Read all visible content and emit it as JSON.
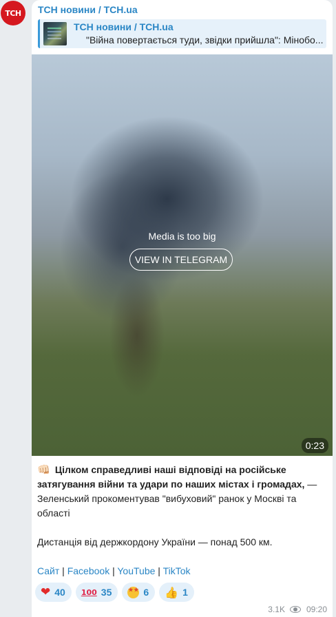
{
  "avatar": {
    "label": "ТСН",
    "color": "#d5181f"
  },
  "post": {
    "channel_name": "ТСН новини / TCH.ua",
    "forward": {
      "title": "ТСН новини / TCH.ua",
      "text": "\"Війна повертається туди, звідки прийшла\": Мінобо..."
    },
    "media": {
      "message": "Media is too big",
      "button_label": "VIEW IN TELEGRAM",
      "duration": "0:23"
    },
    "text": {
      "emoji": "👊🏻",
      "bold": "Цілком справедливі наші відповіді на російське затягування війни та удари по наших містах і громадах,",
      "rest": " — Зеленський прокоментував \"вибуховий\" ранок у Москві та області",
      "paragraph2": "Дистанція від держкордону України — понад 500 км.",
      "links": [
        "Сайт",
        "Facebook",
        "YouTube",
        "TikTok"
      ],
      "separator": " | "
    },
    "reactions": [
      {
        "icon": "heart-icon",
        "glyph": "❤",
        "count": "40"
      },
      {
        "icon": "hundred-icon",
        "glyph": "100",
        "count": "35"
      },
      {
        "icon": "star-struck-icon",
        "glyph": "",
        "count": "6"
      },
      {
        "icon": "thumbs-up-icon",
        "glyph": "👍",
        "count": "1"
      }
    ],
    "meta": {
      "views": "3.1K",
      "time": "09:20"
    }
  }
}
